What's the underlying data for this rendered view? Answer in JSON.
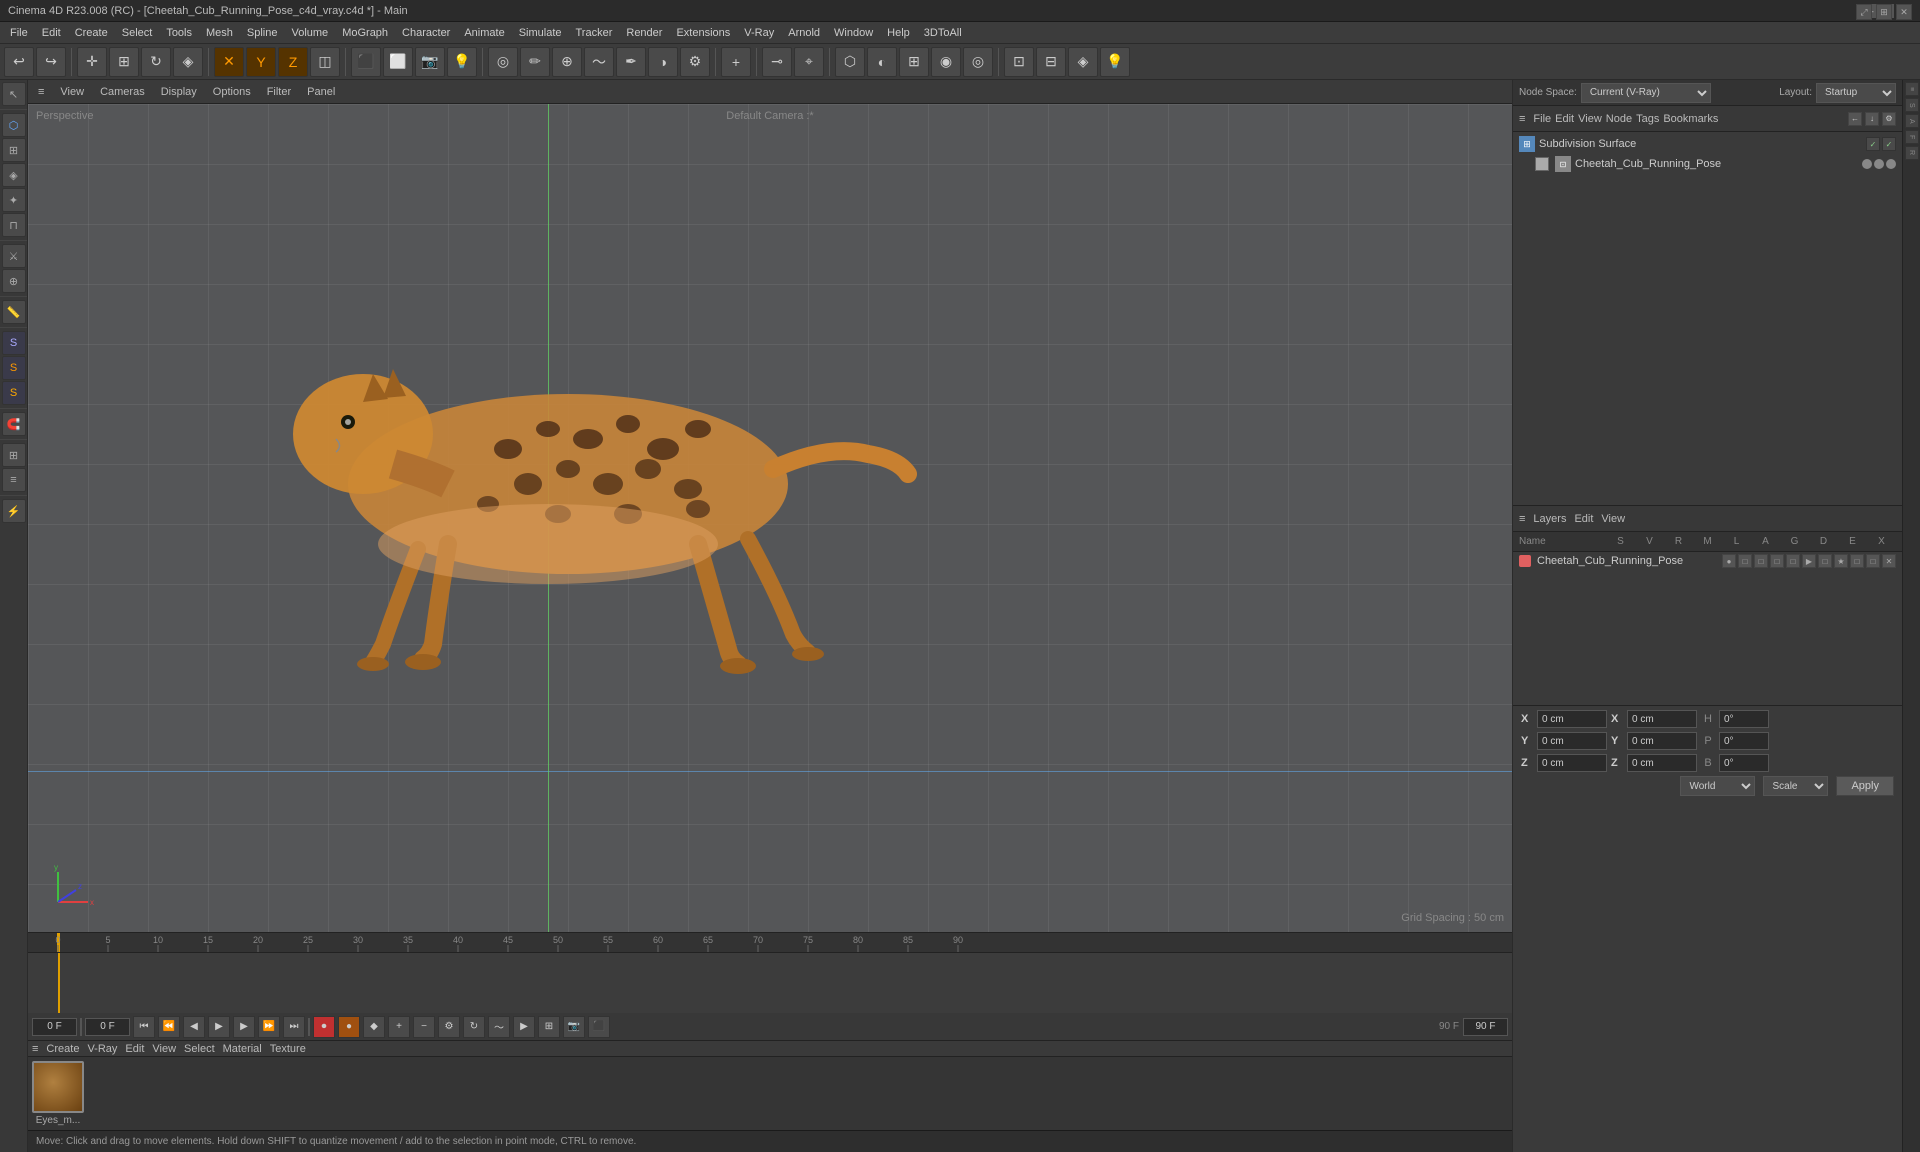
{
  "titleBar": {
    "title": "Cinema 4D R23.008 (RC) - [Cheetah_Cub_Running_Pose_c4d_vray.c4d *] - Main",
    "controls": [
      "—",
      "□",
      "✕"
    ]
  },
  "menuBar": {
    "items": [
      "File",
      "Edit",
      "Create",
      "Select",
      "Tools",
      "Mesh",
      "Spline",
      "Volume",
      "MoGraph",
      "Character",
      "Animate",
      "Simulate",
      "Tracker",
      "Render",
      "Extensions",
      "V-Ray",
      "Arnold",
      "Window",
      "Help",
      "3DToAll"
    ]
  },
  "nodeSpace": {
    "label": "Node Space:",
    "value": "Current (V-Ray)",
    "layoutLabel": "Layout:",
    "layoutValue": "Startup"
  },
  "viewport": {
    "view": "Perspective",
    "camera": "Default Camera :*",
    "gridSpacing": "Grid Spacing : 50 cm",
    "toolbar": [
      "View",
      "Cameras",
      "Display",
      "Options",
      "Filter",
      "Panel"
    ]
  },
  "timeline": {
    "ticks": [
      0,
      5,
      10,
      15,
      20,
      25,
      30,
      35,
      40,
      45,
      50,
      55,
      60,
      65,
      70,
      75,
      80,
      85,
      90
    ],
    "currentFrame": "0 F",
    "startFrame": "0 F",
    "endFrame": "90 F",
    "maxFrame": "90 F"
  },
  "playback": {
    "currentFrame": "0 F",
    "startFrame": "0 F",
    "endFrame": "90 F",
    "maxEndFrame": "90 F"
  },
  "objectManager": {
    "title": "≡",
    "tabs": [
      "Node Space: Current (V-Ray)",
      "Layout: Startup"
    ],
    "toolbarItems": [
      "File",
      "Edit",
      "View",
      "Node",
      "Tags",
      "Bookmarks"
    ],
    "objects": [
      {
        "name": "Subdivision Surface",
        "icon": "cube",
        "color": "#6a9fcb",
        "indent": 0,
        "controls": [
          "check",
          "check"
        ]
      },
      {
        "name": "Cheetah_Cub_Running_Pose",
        "icon": "mesh",
        "color": "#888",
        "indent": 1,
        "controls": [
          "dot",
          "dot",
          "dot"
        ]
      }
    ]
  },
  "layersPanel": {
    "toolbarItems": [
      "Layers",
      "Edit",
      "View"
    ],
    "columns": [
      "Name",
      "S",
      "V",
      "R",
      "M",
      "L",
      "A",
      "G",
      "D",
      "E",
      "X"
    ],
    "layers": [
      {
        "name": "Cheetah_Cub_Running_Pose",
        "color": "#e06060",
        "icons": [
          "●",
          "□",
          "□",
          "□",
          "□",
          "▶",
          "□",
          "★",
          "□",
          "□",
          "□"
        ]
      }
    ]
  },
  "coordinates": {
    "rows": [
      {
        "axis": "X",
        "position": "0 cm",
        "axisR": "X",
        "rotation": "0 cm",
        "labelH": "H",
        "hVal": "0°"
      },
      {
        "axis": "Y",
        "position": "0 cm",
        "axisR": "Y",
        "rotation": "0 cm",
        "labelP": "P",
        "pVal": "0°"
      },
      {
        "axis": "Z",
        "position": "0 cm",
        "axisR": "Z",
        "rotation": "0 cm",
        "labelB": "B",
        "bVal": "0°"
      }
    ],
    "worldLabel": "World",
    "scaleLabel": "Scale",
    "applyLabel": "Apply"
  },
  "materialBar": {
    "toolbarItems": [
      "≡",
      "Create",
      "V-Ray",
      "Edit",
      "View",
      "Select",
      "Material",
      "Texture"
    ],
    "materials": [
      {
        "name": "Eyes_m...",
        "color": "#7a5a20"
      }
    ]
  },
  "statusBar": {
    "text": "Move: Click and drag to move elements. Hold down SHIFT to quantize movement / add to the selection in point mode, CTRL to remove."
  }
}
